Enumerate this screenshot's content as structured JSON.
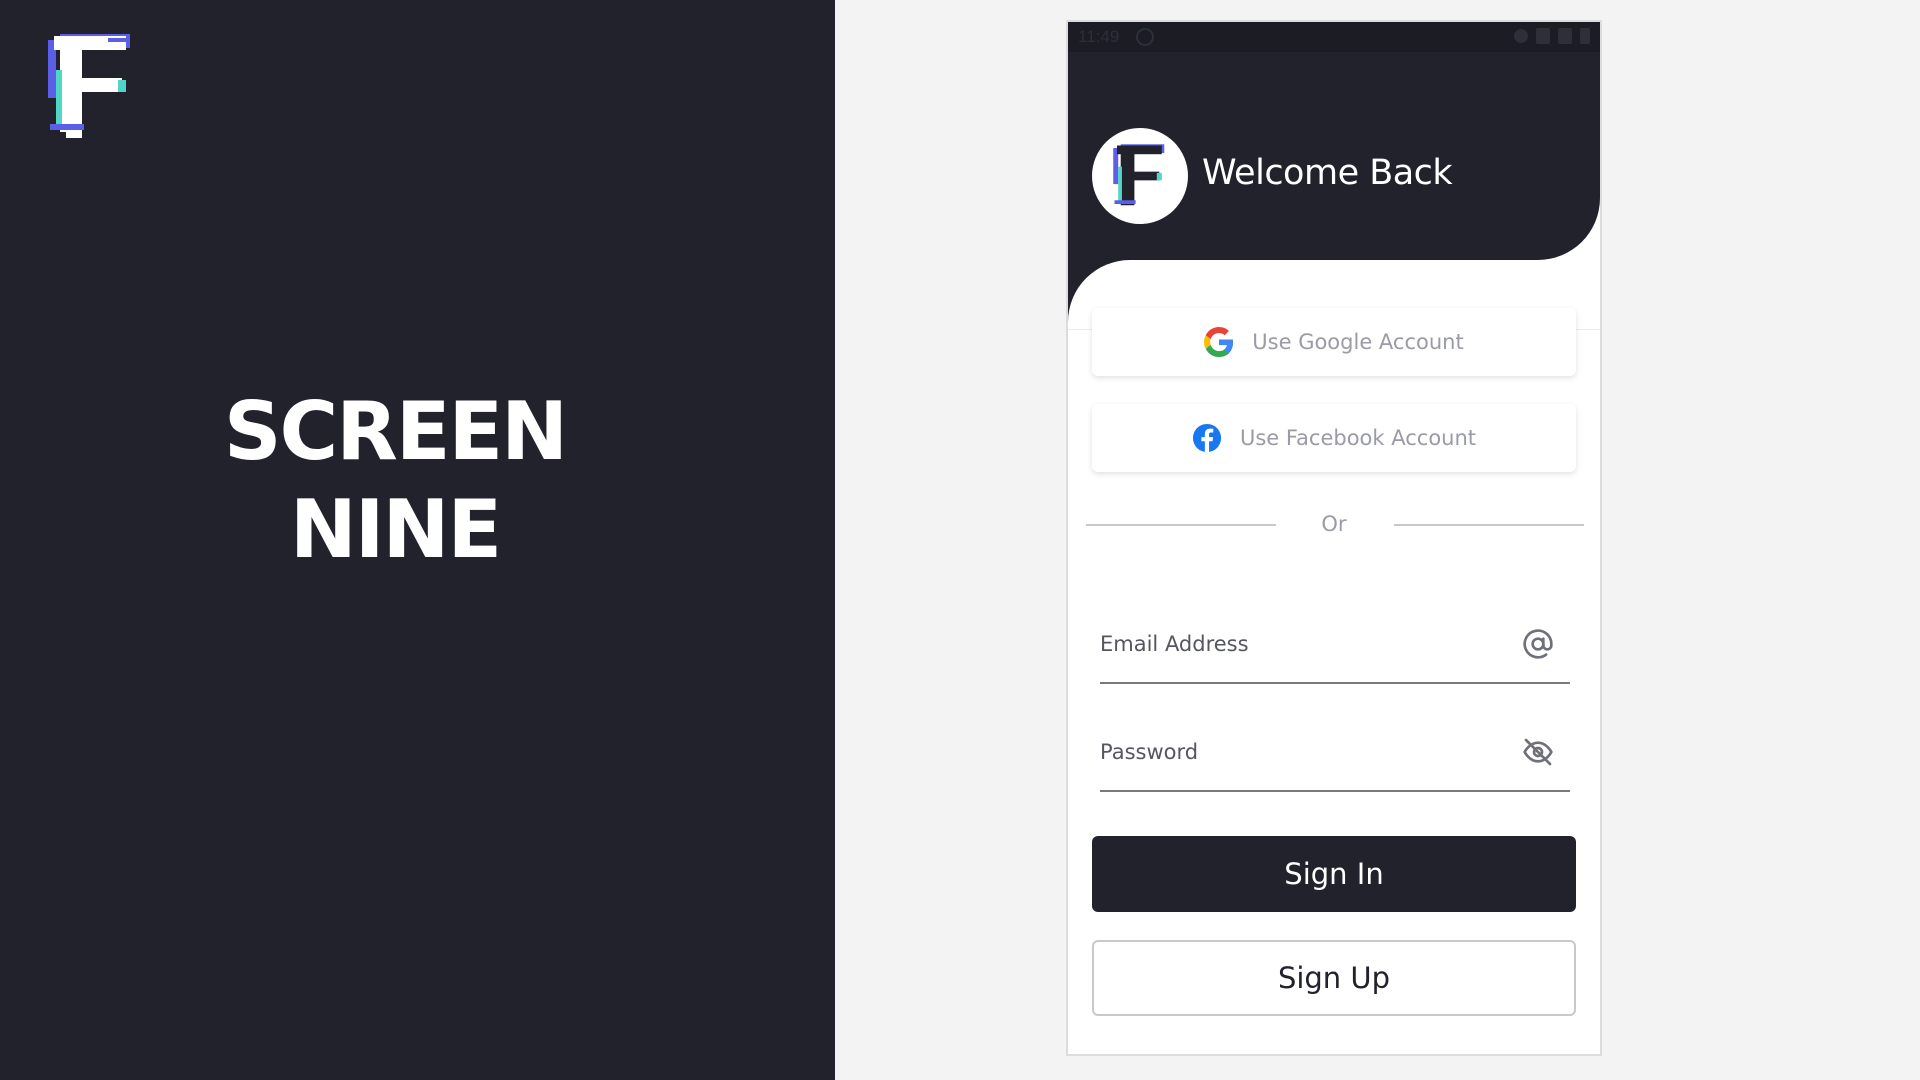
{
  "slide": {
    "title_line1": "SCREEN",
    "title_line2": "NINE"
  },
  "status_bar": {
    "time": "11:49"
  },
  "header": {
    "welcome_text": "Welcome Back"
  },
  "social": {
    "google_label": "Use Google Account",
    "facebook_label": "Use Facebook Account"
  },
  "divider": {
    "text": "Or"
  },
  "form": {
    "email_placeholder": "Email Address",
    "password_placeholder": "Password"
  },
  "actions": {
    "sign_in_label": "Sign In",
    "sign_up_label": "Sign Up"
  },
  "icons": {
    "brand": "brand-f-logo",
    "google": "google-icon",
    "facebook": "facebook-icon",
    "email": "at-icon",
    "password": "eye-off-icon"
  },
  "colors": {
    "dark": "#21222c",
    "panel_bg": "#f3f3f3",
    "facebook_blue": "#1877f2",
    "muted_text": "#9a9ba6"
  }
}
